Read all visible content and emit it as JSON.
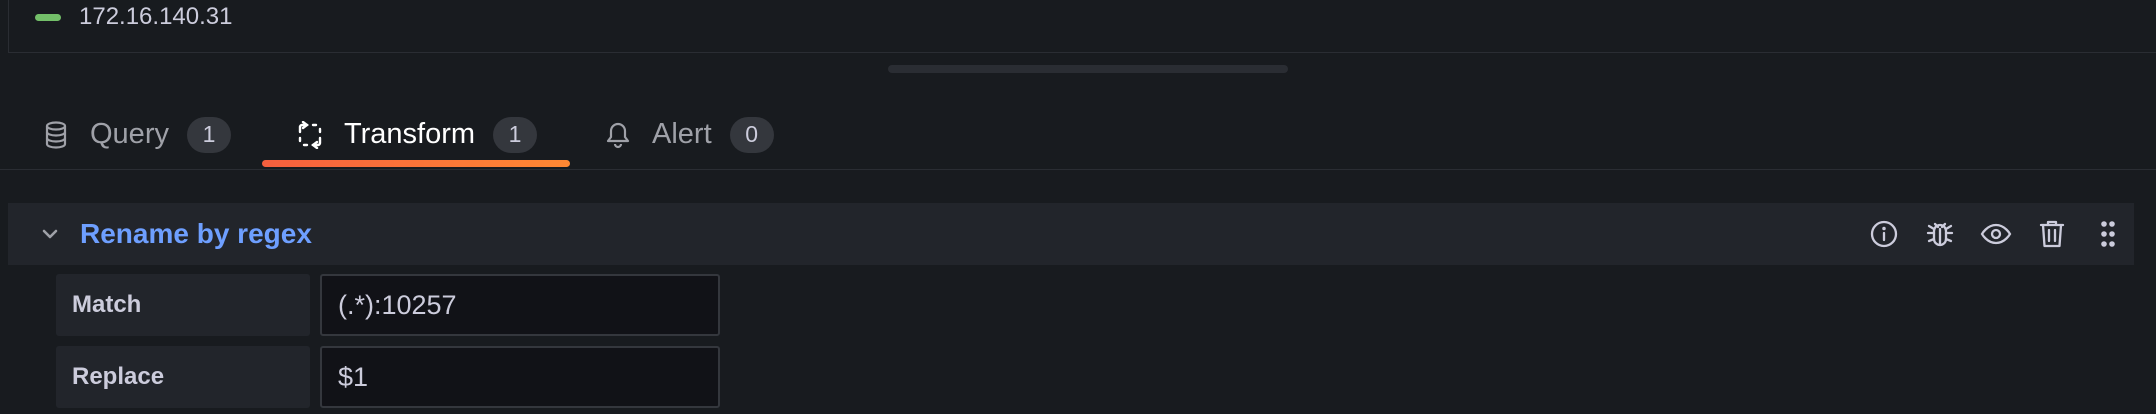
{
  "legend": {
    "items": [
      {
        "label": "172.16.140.31",
        "color": "#73bf69"
      }
    ]
  },
  "tabs": [
    {
      "label": "Query",
      "count": "1",
      "icon": "database-icon",
      "active": false
    },
    {
      "label": "Transform",
      "count": "1",
      "icon": "transform-icon",
      "active": true
    },
    {
      "label": "Alert",
      "count": "0",
      "icon": "bell-icon",
      "active": false
    }
  ],
  "transformation": {
    "title": "Rename by regex",
    "actions": [
      "info-icon",
      "debug-bug-icon",
      "eye-icon",
      "trash-icon",
      "drag-handle-icon"
    ],
    "fields": {
      "match": {
        "label": "Match",
        "value": "(.*):10257"
      },
      "replace": {
        "label": "Replace",
        "value": "$1"
      }
    }
  },
  "colors": {
    "accent_link": "#6e9fff",
    "tab_underline": "#ff8833",
    "legend_series": "#73bf69"
  }
}
